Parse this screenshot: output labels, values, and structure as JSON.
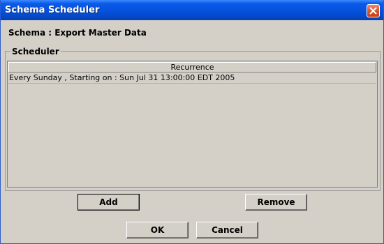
{
  "window": {
    "title": "Schema Scheduler"
  },
  "schema": {
    "label": "Schema : Export Master Data"
  },
  "scheduler": {
    "legend": "Scheduler",
    "columns": [
      "Recurrence"
    ],
    "rows": [
      {
        "recurrence": "Every Sunday , Starting on : Sun Jul 31 13:00:00 EDT 2005"
      }
    ]
  },
  "actions": {
    "add_label": "Add",
    "remove_label": "Remove"
  },
  "dialog_buttons": {
    "ok_label": "OK",
    "cancel_label": "Cancel"
  },
  "icons": {
    "close": "close-icon"
  },
  "colors": {
    "titlebar": "#0552dd",
    "window_bg": "#d4d0c8",
    "close_button": "#d9552f"
  }
}
